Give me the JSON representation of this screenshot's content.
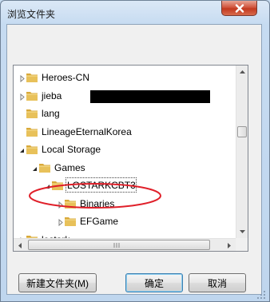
{
  "window": {
    "title": "浏览文件夹"
  },
  "tree": {
    "rows": [
      {
        "label": "Heroes-CN",
        "depth": 0,
        "expander": "collapsed",
        "selected": false,
        "redacted": false
      },
      {
        "label": "jieba",
        "depth": 0,
        "expander": "collapsed",
        "selected": false,
        "redacted": true
      },
      {
        "label": "lang",
        "depth": 0,
        "expander": "none",
        "selected": false,
        "redacted": false
      },
      {
        "label": "LineageEternalKorea",
        "depth": 0,
        "expander": "none",
        "selected": false,
        "redacted": false
      },
      {
        "label": "Local Storage",
        "depth": 0,
        "expander": "expanded",
        "selected": false,
        "redacted": false
      },
      {
        "label": "Games",
        "depth": 1,
        "expander": "expanded",
        "selected": false,
        "redacted": false
      },
      {
        "label": "LOSTARKCBT3",
        "depth": 2,
        "expander": "expanded",
        "selected": true,
        "redacted": false
      },
      {
        "label": "Binaries",
        "depth": 3,
        "expander": "collapsed",
        "selected": false,
        "redacted": false
      },
      {
        "label": "EFGame",
        "depth": 3,
        "expander": "collapsed",
        "selected": false,
        "redacted": false
      },
      {
        "label": "lostark",
        "depth": 0,
        "expander": "collapsed",
        "selected": false,
        "redacted": false
      }
    ]
  },
  "buttons": {
    "new_folder": "新建文件夹(M)",
    "ok": "确定",
    "cancel": "取消"
  },
  "colors": {
    "annotation": "#e0202a",
    "folder": "#e8c15a"
  },
  "icons": {
    "close": "close-icon",
    "folder": "folder-icon",
    "expand": "triangle-expanded-icon",
    "collapse": "triangle-collapsed-icon"
  }
}
